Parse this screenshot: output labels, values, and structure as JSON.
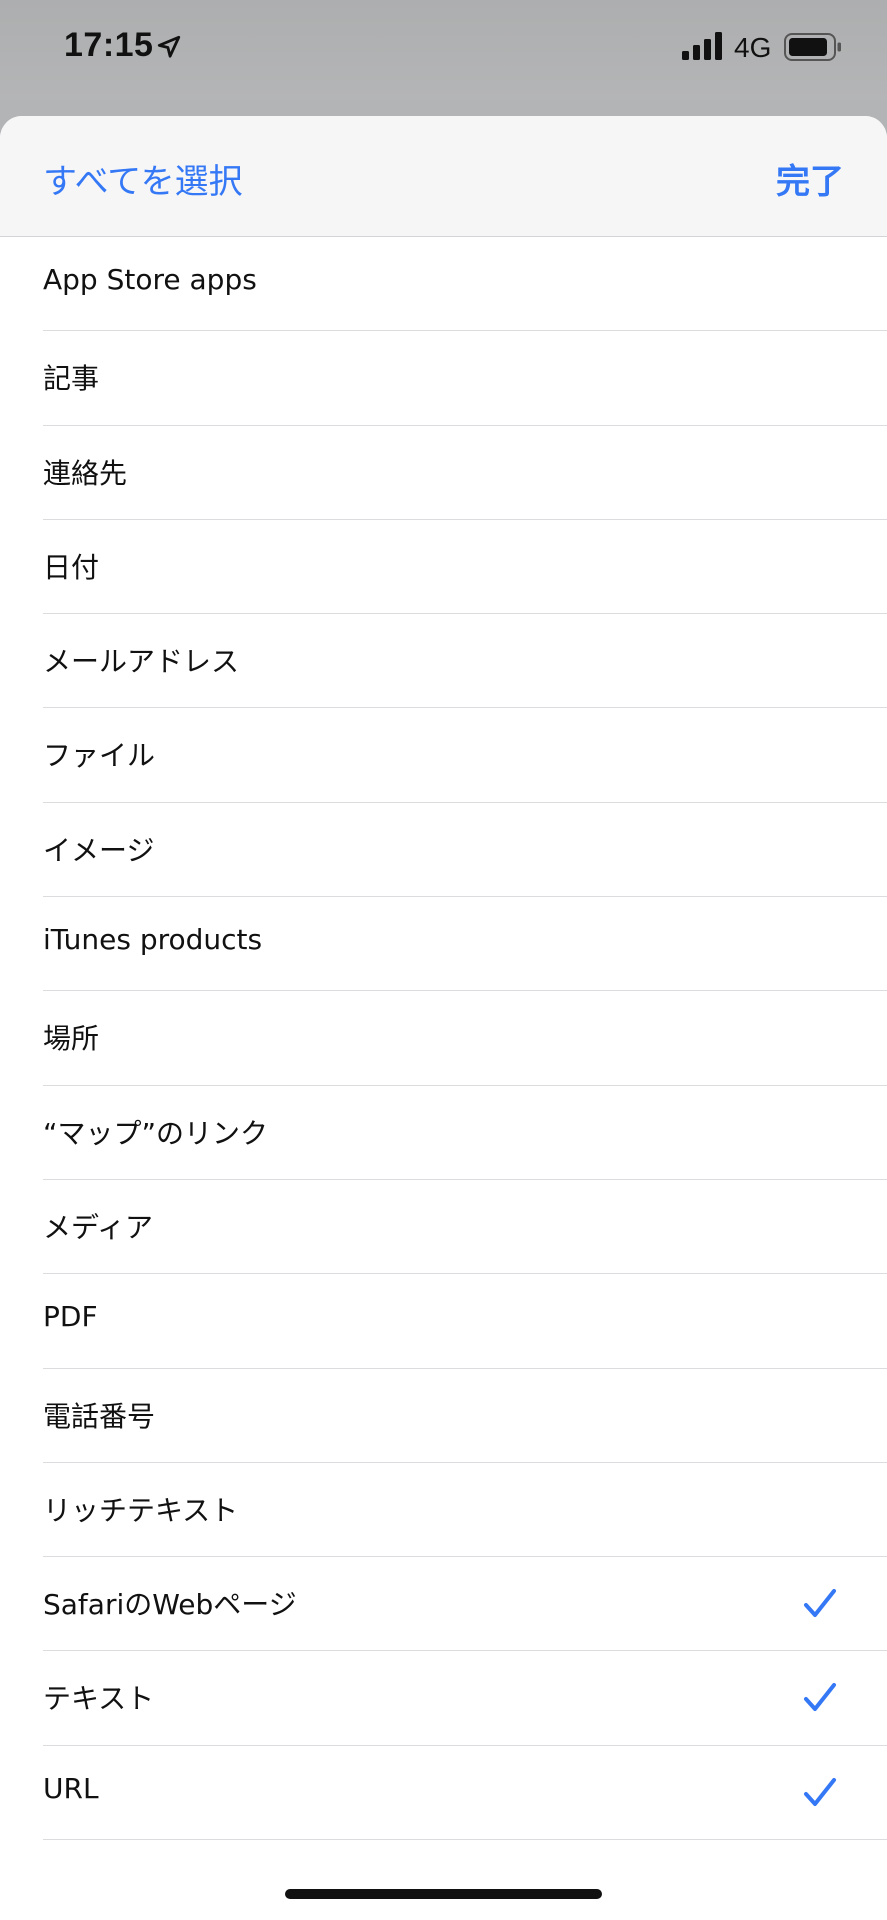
{
  "status_bar": {
    "time": "17:15",
    "network": "4G",
    "icons": [
      "location-arrow-icon",
      "signal-bars-icon",
      "battery-icon"
    ]
  },
  "header": {
    "select_all": "すべてを選択",
    "done": "完了"
  },
  "items": [
    {
      "label": "App Store apps",
      "checked": false
    },
    {
      "label": "記事",
      "checked": false
    },
    {
      "label": "連絡先",
      "checked": false
    },
    {
      "label": "日付",
      "checked": false
    },
    {
      "label": "メールアドレス",
      "checked": false
    },
    {
      "label": "ファイル",
      "checked": false
    },
    {
      "label": "イメージ",
      "checked": false
    },
    {
      "label": "iTunes products",
      "checked": false
    },
    {
      "label": "場所",
      "checked": false
    },
    {
      "label": "“マップ”のリンク",
      "checked": false
    },
    {
      "label": "メディア",
      "checked": false
    },
    {
      "label": "PDF",
      "checked": false
    },
    {
      "label": "電話番号",
      "checked": false
    },
    {
      "label": "リッチテキスト",
      "checked": false
    },
    {
      "label": "SafariのWebページ",
      "checked": true
    },
    {
      "label": "テキスト",
      "checked": true
    },
    {
      "label": "URL",
      "checked": true
    }
  ],
  "colors": {
    "accent": "#3478f6",
    "header_bg": "#f6f6f7",
    "backdrop": "#b3b4b5"
  }
}
